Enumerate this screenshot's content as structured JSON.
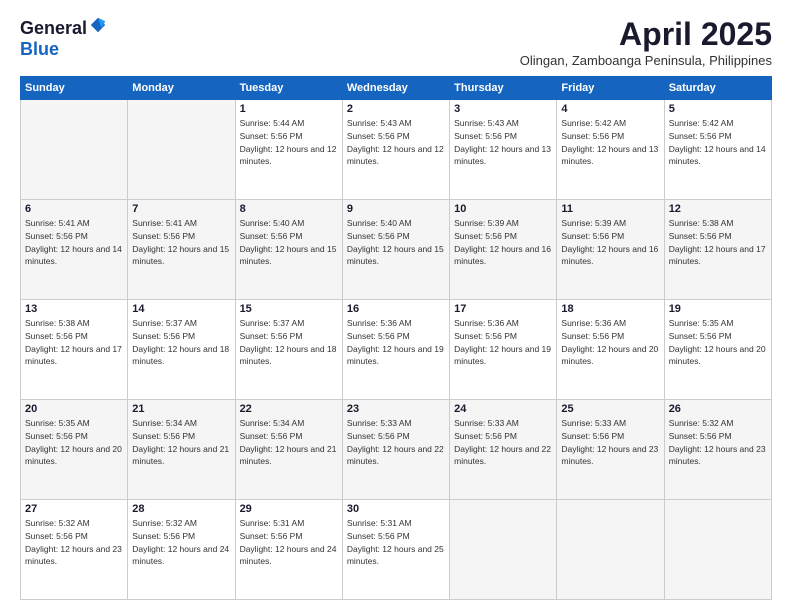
{
  "header": {
    "logo_general": "General",
    "logo_blue": "Blue",
    "month_title": "April 2025",
    "location": "Olingan, Zamboanga Peninsula, Philippines"
  },
  "weekdays": [
    "Sunday",
    "Monday",
    "Tuesday",
    "Wednesday",
    "Thursday",
    "Friday",
    "Saturday"
  ],
  "weeks": [
    [
      {
        "day": "",
        "empty": true
      },
      {
        "day": "",
        "empty": true
      },
      {
        "day": "1",
        "sunrise": "Sunrise: 5:44 AM",
        "sunset": "Sunset: 5:56 PM",
        "daylight": "Daylight: 12 hours and 12 minutes."
      },
      {
        "day": "2",
        "sunrise": "Sunrise: 5:43 AM",
        "sunset": "Sunset: 5:56 PM",
        "daylight": "Daylight: 12 hours and 12 minutes."
      },
      {
        "day": "3",
        "sunrise": "Sunrise: 5:43 AM",
        "sunset": "Sunset: 5:56 PM",
        "daylight": "Daylight: 12 hours and 13 minutes."
      },
      {
        "day": "4",
        "sunrise": "Sunrise: 5:42 AM",
        "sunset": "Sunset: 5:56 PM",
        "daylight": "Daylight: 12 hours and 13 minutes."
      },
      {
        "day": "5",
        "sunrise": "Sunrise: 5:42 AM",
        "sunset": "Sunset: 5:56 PM",
        "daylight": "Daylight: 12 hours and 14 minutes."
      }
    ],
    [
      {
        "day": "6",
        "sunrise": "Sunrise: 5:41 AM",
        "sunset": "Sunset: 5:56 PM",
        "daylight": "Daylight: 12 hours and 14 minutes."
      },
      {
        "day": "7",
        "sunrise": "Sunrise: 5:41 AM",
        "sunset": "Sunset: 5:56 PM",
        "daylight": "Daylight: 12 hours and 15 minutes."
      },
      {
        "day": "8",
        "sunrise": "Sunrise: 5:40 AM",
        "sunset": "Sunset: 5:56 PM",
        "daylight": "Daylight: 12 hours and 15 minutes."
      },
      {
        "day": "9",
        "sunrise": "Sunrise: 5:40 AM",
        "sunset": "Sunset: 5:56 PM",
        "daylight": "Daylight: 12 hours and 15 minutes."
      },
      {
        "day": "10",
        "sunrise": "Sunrise: 5:39 AM",
        "sunset": "Sunset: 5:56 PM",
        "daylight": "Daylight: 12 hours and 16 minutes."
      },
      {
        "day": "11",
        "sunrise": "Sunrise: 5:39 AM",
        "sunset": "Sunset: 5:56 PM",
        "daylight": "Daylight: 12 hours and 16 minutes."
      },
      {
        "day": "12",
        "sunrise": "Sunrise: 5:38 AM",
        "sunset": "Sunset: 5:56 PM",
        "daylight": "Daylight: 12 hours and 17 minutes."
      }
    ],
    [
      {
        "day": "13",
        "sunrise": "Sunrise: 5:38 AM",
        "sunset": "Sunset: 5:56 PM",
        "daylight": "Daylight: 12 hours and 17 minutes."
      },
      {
        "day": "14",
        "sunrise": "Sunrise: 5:37 AM",
        "sunset": "Sunset: 5:56 PM",
        "daylight": "Daylight: 12 hours and 18 minutes."
      },
      {
        "day": "15",
        "sunrise": "Sunrise: 5:37 AM",
        "sunset": "Sunset: 5:56 PM",
        "daylight": "Daylight: 12 hours and 18 minutes."
      },
      {
        "day": "16",
        "sunrise": "Sunrise: 5:36 AM",
        "sunset": "Sunset: 5:56 PM",
        "daylight": "Daylight: 12 hours and 19 minutes."
      },
      {
        "day": "17",
        "sunrise": "Sunrise: 5:36 AM",
        "sunset": "Sunset: 5:56 PM",
        "daylight": "Daylight: 12 hours and 19 minutes."
      },
      {
        "day": "18",
        "sunrise": "Sunrise: 5:36 AM",
        "sunset": "Sunset: 5:56 PM",
        "daylight": "Daylight: 12 hours and 20 minutes."
      },
      {
        "day": "19",
        "sunrise": "Sunrise: 5:35 AM",
        "sunset": "Sunset: 5:56 PM",
        "daylight": "Daylight: 12 hours and 20 minutes."
      }
    ],
    [
      {
        "day": "20",
        "sunrise": "Sunrise: 5:35 AM",
        "sunset": "Sunset: 5:56 PM",
        "daylight": "Daylight: 12 hours and 20 minutes."
      },
      {
        "day": "21",
        "sunrise": "Sunrise: 5:34 AM",
        "sunset": "Sunset: 5:56 PM",
        "daylight": "Daylight: 12 hours and 21 minutes."
      },
      {
        "day": "22",
        "sunrise": "Sunrise: 5:34 AM",
        "sunset": "Sunset: 5:56 PM",
        "daylight": "Daylight: 12 hours and 21 minutes."
      },
      {
        "day": "23",
        "sunrise": "Sunrise: 5:33 AM",
        "sunset": "Sunset: 5:56 PM",
        "daylight": "Daylight: 12 hours and 22 minutes."
      },
      {
        "day": "24",
        "sunrise": "Sunrise: 5:33 AM",
        "sunset": "Sunset: 5:56 PM",
        "daylight": "Daylight: 12 hours and 22 minutes."
      },
      {
        "day": "25",
        "sunrise": "Sunrise: 5:33 AM",
        "sunset": "Sunset: 5:56 PM",
        "daylight": "Daylight: 12 hours and 23 minutes."
      },
      {
        "day": "26",
        "sunrise": "Sunrise: 5:32 AM",
        "sunset": "Sunset: 5:56 PM",
        "daylight": "Daylight: 12 hours and 23 minutes."
      }
    ],
    [
      {
        "day": "27",
        "sunrise": "Sunrise: 5:32 AM",
        "sunset": "Sunset: 5:56 PM",
        "daylight": "Daylight: 12 hours and 23 minutes."
      },
      {
        "day": "28",
        "sunrise": "Sunrise: 5:32 AM",
        "sunset": "Sunset: 5:56 PM",
        "daylight": "Daylight: 12 hours and 24 minutes."
      },
      {
        "day": "29",
        "sunrise": "Sunrise: 5:31 AM",
        "sunset": "Sunset: 5:56 PM",
        "daylight": "Daylight: 12 hours and 24 minutes."
      },
      {
        "day": "30",
        "sunrise": "Sunrise: 5:31 AM",
        "sunset": "Sunset: 5:56 PM",
        "daylight": "Daylight: 12 hours and 25 minutes."
      },
      {
        "day": "",
        "empty": true
      },
      {
        "day": "",
        "empty": true
      },
      {
        "day": "",
        "empty": true
      }
    ]
  ]
}
